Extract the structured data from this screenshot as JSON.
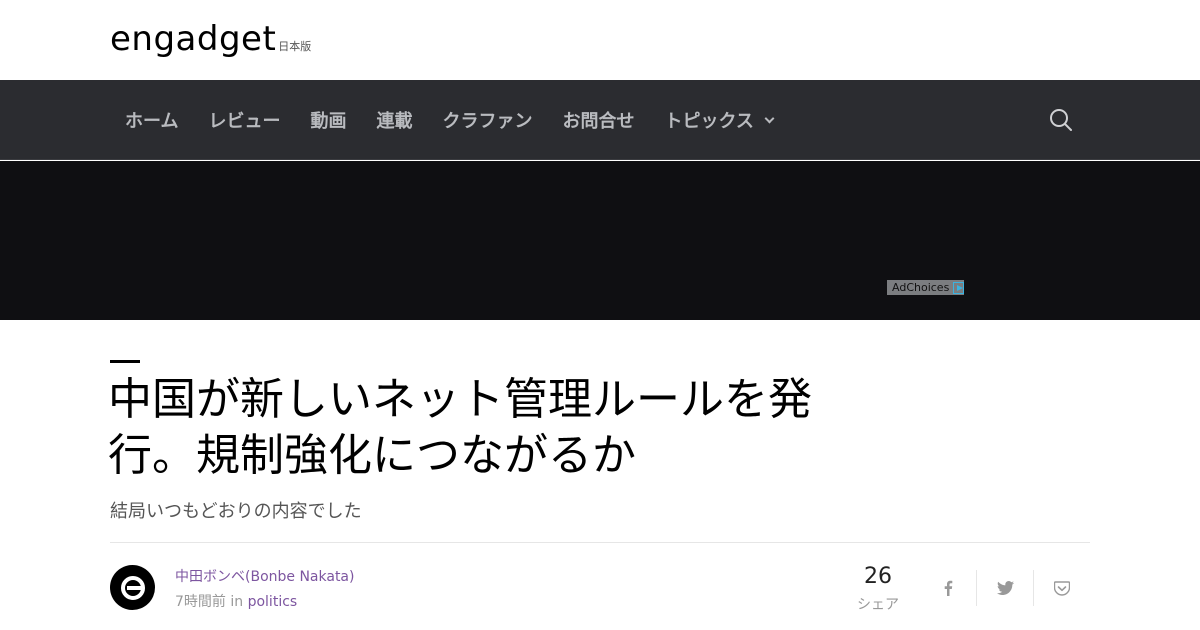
{
  "header": {
    "logo_text": "engadget",
    "logo_sub": "日本版"
  },
  "nav": {
    "items": [
      {
        "label": "ホーム"
      },
      {
        "label": "レビュー"
      },
      {
        "label": "動画"
      },
      {
        "label": "連載"
      },
      {
        "label": "クラファン"
      },
      {
        "label": "お問合せ"
      },
      {
        "label": "トピックス"
      }
    ]
  },
  "ad": {
    "adchoices_label": "AdChoices"
  },
  "article": {
    "title_line1": "中国が新しいネット管理ルールを発",
    "title_line2": "行。規制強化につながるか",
    "subtitle": "結局いつもどおりの内容でした",
    "author": "中田ボンベ(Bonbe Nakata)",
    "time": "7時間前",
    "in_word": "in",
    "category": "politics"
  },
  "share": {
    "count": "26",
    "label": "シェア",
    "buttons": [
      "facebook-icon",
      "twitter-icon",
      "pocket-icon"
    ]
  },
  "colors": {
    "navbar_bg": "#2b2c30",
    "ad_bg": "#0f0f12",
    "accent": "#7d56a0"
  }
}
